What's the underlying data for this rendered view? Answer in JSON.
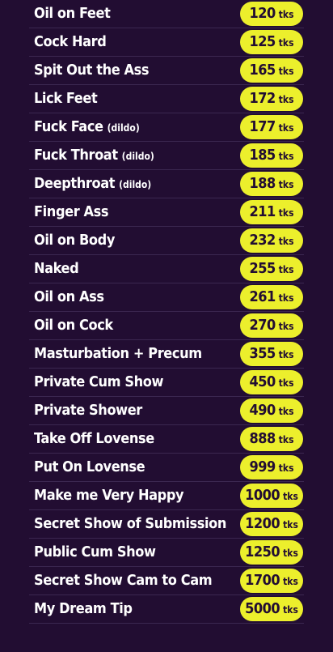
{
  "currency_unit": "tks",
  "items": [
    {
      "name": "Oil on Feet",
      "note": "",
      "price": "120"
    },
    {
      "name": "Cock Hard",
      "note": "",
      "price": "125"
    },
    {
      "name": "Spit Out the Ass",
      "note": "",
      "price": "165"
    },
    {
      "name": "Lick Feet",
      "note": "",
      "price": "172"
    },
    {
      "name": "Fuck Face",
      "note": "(dildo)",
      "price": "177"
    },
    {
      "name": "Fuck Throat",
      "note": "(dildo)",
      "price": "185"
    },
    {
      "name": "Deepthroat",
      "note": "(dildo)",
      "price": "188"
    },
    {
      "name": "Finger Ass",
      "note": "",
      "price": "211"
    },
    {
      "name": "Oil on Body",
      "note": "",
      "price": "232"
    },
    {
      "name": "Naked",
      "note": "",
      "price": "255"
    },
    {
      "name": "Oil on Ass",
      "note": "",
      "price": "261"
    },
    {
      "name": "Oil on Cock",
      "note": "",
      "price": "270"
    },
    {
      "name": "Masturbation + Precum",
      "note": "",
      "price": "355"
    },
    {
      "name": "Private Cum Show",
      "note": "",
      "price": "450"
    },
    {
      "name": "Private Shower",
      "note": "",
      "price": "490"
    },
    {
      "name": "Take Off Lovense",
      "note": "",
      "price": "888"
    },
    {
      "name": "Put On Lovense",
      "note": "",
      "price": "999"
    },
    {
      "name": "Make me Very Happy",
      "note": "",
      "price": "1000"
    },
    {
      "name": "Secret Show of Submission",
      "note": "",
      "price": "1200"
    },
    {
      "name": "Public Cum Show",
      "note": "",
      "price": "1250"
    },
    {
      "name": "Secret Show Cam to Cam",
      "note": "",
      "price": "1700"
    },
    {
      "name": "My Dream Tip",
      "note": "",
      "price": "5000"
    }
  ],
  "colors": {
    "background": "#220d32",
    "pill": "#ecef2c",
    "text": "#ffffff",
    "divider": "#3b2750"
  }
}
